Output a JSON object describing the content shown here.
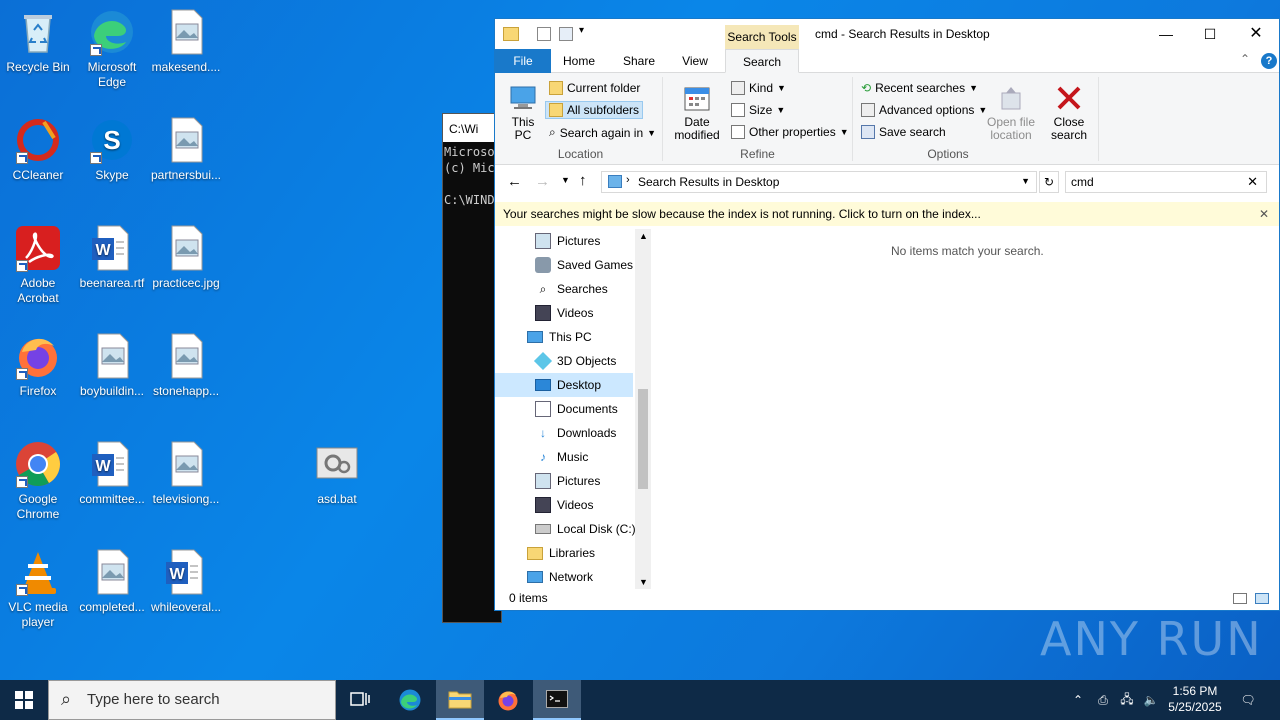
{
  "desktop": {
    "icons": [
      {
        "label": "Recycle Bin"
      },
      {
        "label": "Microsoft Edge"
      },
      {
        "label": "makesend...."
      },
      {
        "label": "CCleaner"
      },
      {
        "label": "Skype"
      },
      {
        "label": "partnersbui..."
      },
      {
        "label": "Adobe Acrobat"
      },
      {
        "label": "beenarea.rtf"
      },
      {
        "label": "practicec.jpg"
      },
      {
        "label": "Firefox"
      },
      {
        "label": "boybuildin..."
      },
      {
        "label": "stonehapp..."
      },
      {
        "label": "Google Chrome"
      },
      {
        "label": "committee..."
      },
      {
        "label": "televisiong..."
      },
      {
        "label": "asd.bat"
      },
      {
        "label": "VLC media player"
      },
      {
        "label": "completed..."
      },
      {
        "label": "whileoveral..."
      }
    ]
  },
  "cmd": {
    "title": "C:\\Wi",
    "lines": [
      "Microsoft",
      "(c) Micr",
      "",
      "C:\\WINDO"
    ]
  },
  "explorer": {
    "title": "cmd - Search Results in Desktop",
    "contextual_tab": "Search Tools",
    "tabs": [
      "File",
      "Home",
      "Share",
      "View",
      "Search"
    ],
    "ribbon": {
      "location": {
        "this_pc": "This PC",
        "current_folder": "Current folder",
        "all_subfolders": "All subfolders",
        "search_again": "Search again in",
        "label": "Location"
      },
      "refine": {
        "date_modified": "Date modified",
        "kind": "Kind",
        "size": "Size",
        "other_properties": "Other properties",
        "label": "Refine"
      },
      "options": {
        "recent_searches": "Recent searches",
        "advanced_options": "Advanced options",
        "save_search": "Save search",
        "open_file_location": "Open file location",
        "close_search": "Close search",
        "label": "Options"
      }
    },
    "address": "Search Results in Desktop",
    "search_value": "cmd",
    "infobar": "Your searches might be slow because the index is not running.  Click to turn on the index...",
    "nav": [
      {
        "label": "Pictures"
      },
      {
        "label": "Saved Games"
      },
      {
        "label": "Searches"
      },
      {
        "label": "Videos"
      },
      {
        "label": "This PC"
      },
      {
        "label": "3D Objects"
      },
      {
        "label": "Desktop"
      },
      {
        "label": "Documents"
      },
      {
        "label": "Downloads"
      },
      {
        "label": "Music"
      },
      {
        "label": "Pictures"
      },
      {
        "label": "Videos"
      },
      {
        "label": "Local Disk (C:)"
      },
      {
        "label": "Libraries"
      },
      {
        "label": "Network"
      }
    ],
    "empty_message": "No items match your search.",
    "status": "0 items"
  },
  "watermark": "ANY RUN",
  "taskbar": {
    "search_placeholder": "Type here to search",
    "time": "1:56 PM",
    "date": "5/25/2025"
  }
}
